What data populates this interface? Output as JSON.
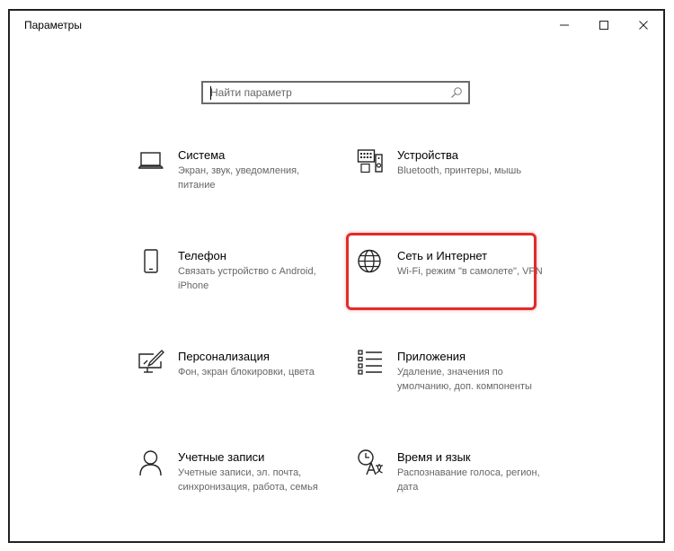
{
  "window": {
    "title": "Параметры",
    "controls": [
      "minimize-icon",
      "maximize-icon",
      "close-icon"
    ]
  },
  "search": {
    "placeholder": "Найти параметр",
    "value": ""
  },
  "tiles": [
    {
      "icon": "laptop-icon",
      "title": "Система",
      "description": "Экран, звук, уведомления, питание"
    },
    {
      "icon": "devices-icon",
      "title": "Устройства",
      "description": "Bluetooth, принтеры, мышь"
    },
    {
      "icon": "phone-icon",
      "title": "Телефон",
      "description": "Связать устройство с Android, iPhone"
    },
    {
      "icon": "globe-icon",
      "title": "Сеть и Интернет",
      "description": "Wi-Fi, режим \"в самолете\", VPN",
      "highlighted": true
    },
    {
      "icon": "personalization-icon",
      "title": "Персонализация",
      "description": "Фон, экран блокировки, цвета"
    },
    {
      "icon": "apps-icon",
      "title": "Приложения",
      "description": "Удаление, значения по умолчанию, доп. компоненты"
    },
    {
      "icon": "person-icon",
      "title": "Учетные записи",
      "description": "Учетные записи, эл. почта, синхронизация, работа, семья"
    },
    {
      "icon": "time-language-icon",
      "title": "Время и язык",
      "description": "Распознавание голоса, регион, дата"
    }
  ],
  "colors": {
    "highlight": "#e22b2b",
    "text": "#000000",
    "secondary_text": "#666666",
    "background": "#ffffff"
  }
}
